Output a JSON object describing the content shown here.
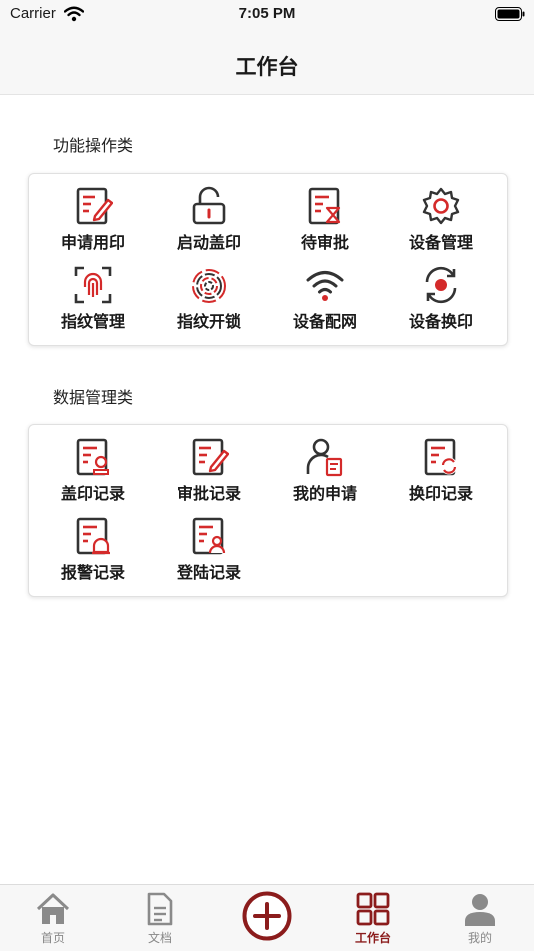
{
  "status_bar": {
    "carrier": "Carrier",
    "time": "7:05 PM"
  },
  "nav": {
    "title": "工作台"
  },
  "colors": {
    "accent": "#d42a2a",
    "dark": "#333333",
    "active_tab": "#8b1c1c",
    "inactive_tab": "#8a8a8a"
  },
  "sections": [
    {
      "title": "功能操作类",
      "items": [
        {
          "label": "申请用印",
          "icon": "apply-seal-icon"
        },
        {
          "label": "启动盖印",
          "icon": "unlock-icon"
        },
        {
          "label": "待审批",
          "icon": "pending-approval-icon"
        },
        {
          "label": "设备管理",
          "icon": "gear-icon"
        },
        {
          "label": "指纹管理",
          "icon": "fingerprint-scan-icon"
        },
        {
          "label": "指纹开锁",
          "icon": "fingerprint-icon"
        },
        {
          "label": "设备配网",
          "icon": "wifi-icon"
        },
        {
          "label": "设备换印",
          "icon": "refresh-icon"
        }
      ]
    },
    {
      "title": "数据管理类",
      "items": [
        {
          "label": "盖印记录",
          "icon": "seal-record-icon"
        },
        {
          "label": "审批记录",
          "icon": "approval-record-icon"
        },
        {
          "label": "我的申请",
          "icon": "my-application-icon"
        },
        {
          "label": "换印记录",
          "icon": "change-seal-record-icon"
        },
        {
          "label": "报警记录",
          "icon": "alarm-record-icon"
        },
        {
          "label": "登陆记录",
          "icon": "login-record-icon"
        }
      ]
    }
  ],
  "tabs": [
    {
      "label": "首页",
      "icon": "home-icon",
      "active": false
    },
    {
      "label": "文档",
      "icon": "document-icon",
      "active": false
    },
    {
      "label": "",
      "icon": "add-circle-icon",
      "active": false
    },
    {
      "label": "工作台",
      "icon": "grid-icon",
      "active": true
    },
    {
      "label": "我的",
      "icon": "user-icon",
      "active": false
    }
  ]
}
